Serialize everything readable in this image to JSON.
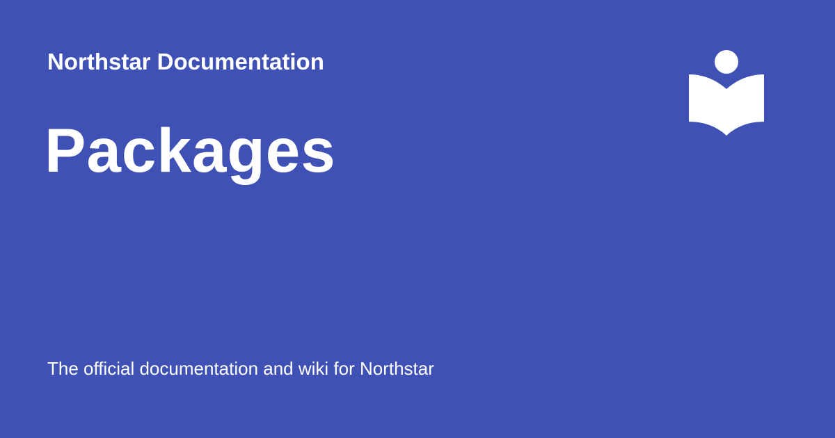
{
  "header": {
    "site_name": "Northstar Documentation"
  },
  "page": {
    "title": "Packages",
    "tagline": "The official documentation and wiki for Northstar"
  },
  "logo": {
    "icon": "reader-book-icon"
  },
  "colors": {
    "background": "#3f51b5",
    "text": "#ffffff",
    "logo": "#ffffff"
  }
}
